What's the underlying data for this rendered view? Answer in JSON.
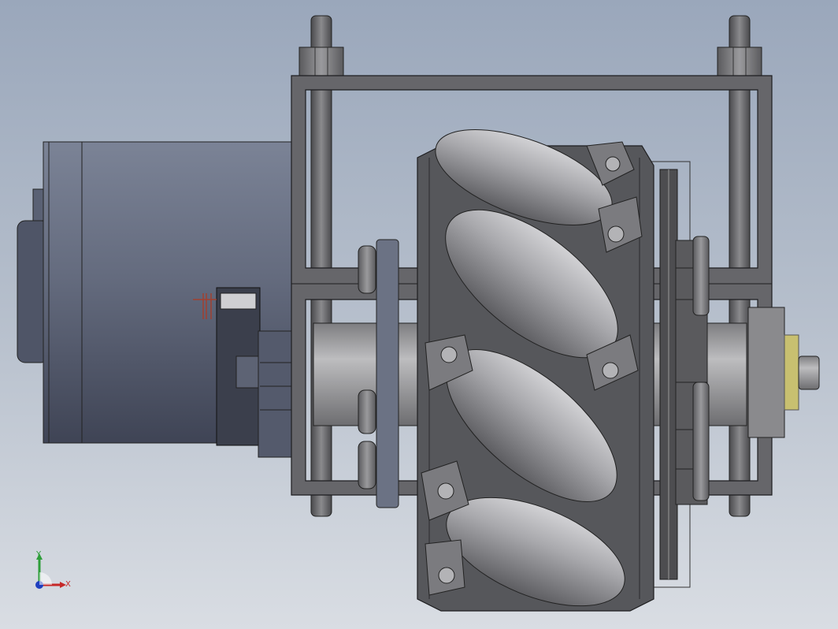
{
  "viewport": {
    "background_top": "#9aa7bb",
    "background_bottom": "#d9dde3"
  },
  "model": {
    "parts": [
      "motor",
      "motor-mount-frame",
      "mecanum-wheel",
      "sprocket",
      "threaded-rods",
      "output-shaft"
    ],
    "colors": {
      "motor": "#5e6578",
      "frame": "#6a6a6e",
      "roller": "#a9a9ad",
      "hub": "#55565a",
      "shaft": "#9c9c9e",
      "bushing": "#c8c070",
      "flange": "#6b7284"
    }
  },
  "triad": {
    "x_label": "X",
    "y_label": "Y",
    "x_color": "#c62828",
    "y_color": "#2e9e3a",
    "z_color": "#1f3fbf"
  }
}
